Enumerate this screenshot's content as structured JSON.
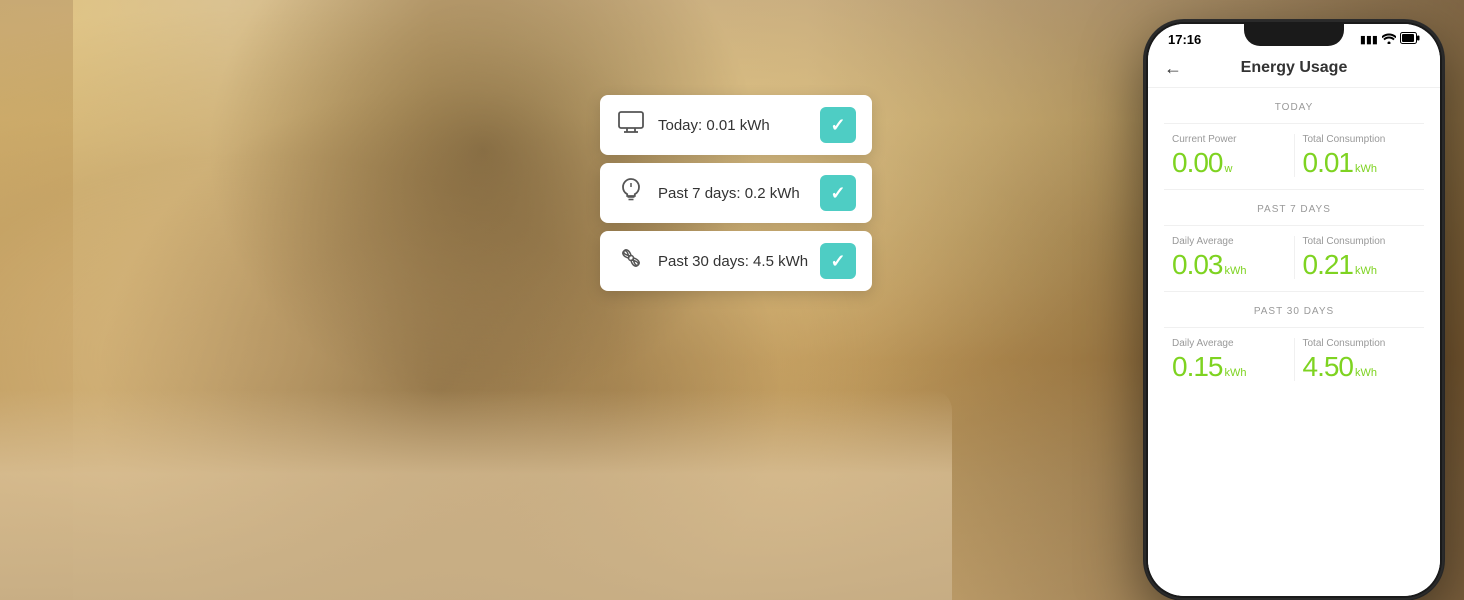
{
  "background": {
    "alt": "Woman relaxing on sofa with phone and wine"
  },
  "floating_cards": {
    "card1": {
      "icon": "monitor",
      "text": "Today: 0.01 kWh",
      "check": "✓"
    },
    "card2": {
      "icon": "bulb",
      "text": "Past 7 days: 0.2 kWh",
      "check": "✓"
    },
    "card3": {
      "icon": "fan",
      "text": "Past 30 days: 4.5 kWh",
      "check": "✓"
    }
  },
  "phone": {
    "status_bar": {
      "time": "17:16",
      "signal": "▮▮▮",
      "wifi": "WiFi",
      "battery": "🔋"
    },
    "header": {
      "back_label": "←",
      "title": "Energy Usage"
    },
    "today_section": {
      "label": "TODAY",
      "current_power": {
        "label": "Current Power",
        "value": "0.00",
        "unit": "w"
      },
      "total_consumption": {
        "label": "Total Consumption",
        "value": "0.01",
        "unit": "kWh"
      }
    },
    "past7_section": {
      "label": "PAST 7 DAYS",
      "daily_average": {
        "label": "Daily Average",
        "value": "0.03",
        "unit": "kWh"
      },
      "total_consumption": {
        "label": "Total Consumption",
        "value": "0.21",
        "unit": "kWh"
      }
    },
    "past30_section": {
      "label": "PAST 30 DAYS",
      "daily_average": {
        "label": "Daily Average",
        "value": "0.15",
        "unit": "kWh"
      },
      "total_consumption": {
        "label": "Total Consumption",
        "value": "4.50",
        "unit": "kWh"
      }
    }
  },
  "colors": {
    "teal": "#4ecdc4",
    "green": "#7ed321",
    "phone_bg": "#1a1a1a"
  }
}
